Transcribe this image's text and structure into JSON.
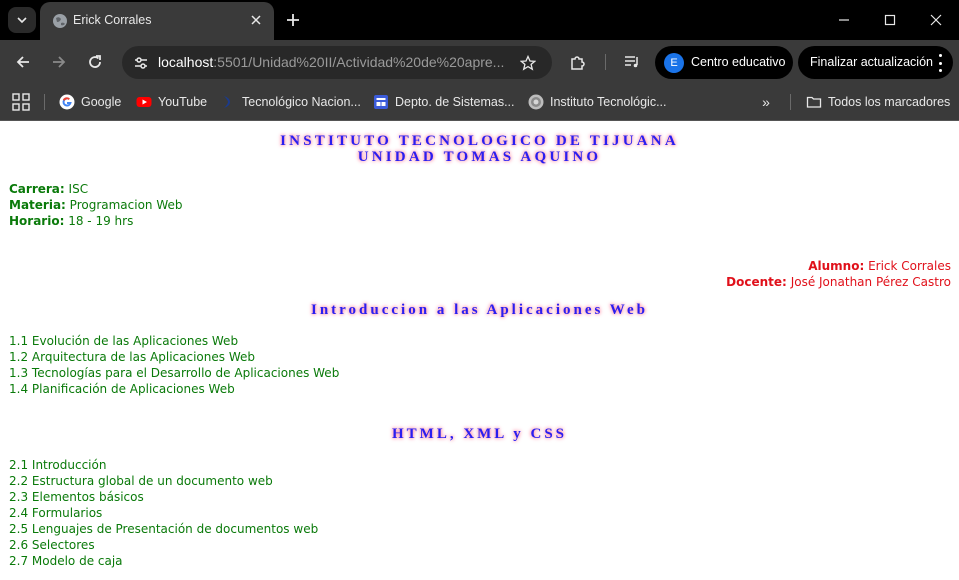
{
  "browser": {
    "tab_title": "Erick Corrales",
    "url_host": "localhost",
    "url_rest": ":5501/Unidad%20II/Actividad%20de%20apre...",
    "profile_initial": "E",
    "profile_label": "Centro educativo",
    "update_label": "Finalizar actualización",
    "bookmarks": [
      {
        "label": "Google",
        "icon": "google-icon"
      },
      {
        "label": "YouTube",
        "icon": "youtube-icon"
      },
      {
        "label": "Tecnológico Nacion...",
        "icon": "tecnm-icon"
      },
      {
        "label": "Depto. de Sistemas...",
        "icon": "sistemas-icon"
      },
      {
        "label": "Instituto Tecnológic...",
        "icon": "instituto-icon"
      }
    ],
    "all_bookmarks_label": "Todos los marcadores",
    "overflow_glyph": "»"
  },
  "page": {
    "institution_line1": "INSTITUTO TECNOLOGICO DE TIJUANA",
    "institution_line2": "UNIDAD TOMAS AQUINO",
    "info": [
      {
        "key": "Carrera:",
        "value": "ISC"
      },
      {
        "key": "Materia:",
        "value": "Programacion Web"
      },
      {
        "key": "Horario:",
        "value": "18 - 19 hrs"
      }
    ],
    "people": [
      {
        "key": "Alumno:",
        "value": "Erick Corrales"
      },
      {
        "key": "Docente:",
        "value": "José Jonathan Pérez Castro"
      }
    ],
    "sections": [
      {
        "title": "Introduccion a las Aplicaciones Web",
        "topics": [
          "1.1 Evolución de las Aplicaciones Web",
          "1.2 Arquitectura de las Aplicaciones Web",
          "1.3 Tecnologías para el Desarrollo de Aplicaciones Web",
          "1.4 Planificación de Aplicaciones Web"
        ]
      },
      {
        "title": "HTML, XML y CSS",
        "topics": [
          "2.1 Introducción",
          "2.2 Estructura global de un documento web",
          "2.3 Elementos básicos",
          "2.4 Formularios",
          "2.5 Lenguajes de Presentación de documentos web",
          "2.6 Selectores",
          "2.7 Modelo de caja"
        ]
      }
    ]
  },
  "colors": {
    "title_blue": "#2a1ef0",
    "title_glow": "#ff8fa8",
    "info_green": "#0a7a0a",
    "people_red": "#e0101a",
    "chrome_dark": "#3a3a3a"
  }
}
